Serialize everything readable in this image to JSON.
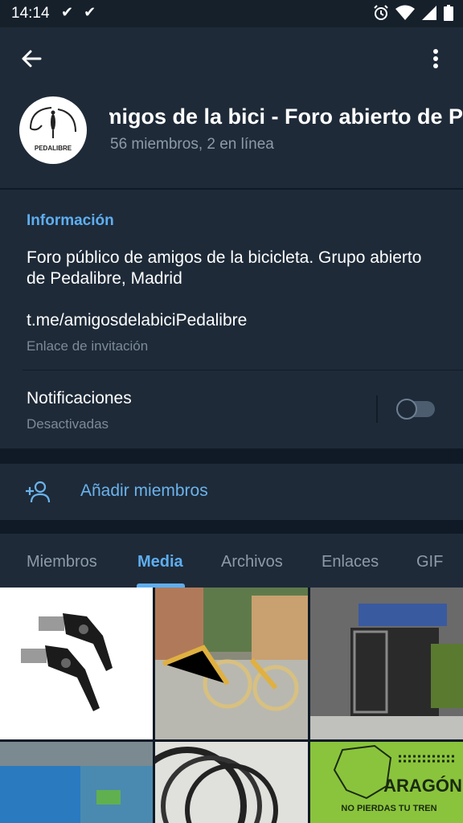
{
  "status_bar": {
    "time": "14:14",
    "checks": "✔ ✔"
  },
  "header": {
    "title": "Amigos de la bici - Foro abierto de Pedalibre    Amigos de la bici",
    "subtitle": "56 miembros, 2 en línea",
    "avatar_text": "PEDALIBRE"
  },
  "info": {
    "section_title": "Información",
    "description": "Foro público de amigos de la bicicleta. Grupo abierto de Pedalibre, Madrid",
    "link": "t.me/amigosdelabiciPedalibre",
    "link_label": "Enlace de invitación",
    "notifications_label": "Notificaciones",
    "notifications_state": "Desactivadas",
    "notifications_on": false
  },
  "add_members": {
    "label": "Añadir miembros"
  },
  "tabs": [
    {
      "label": "Miembros",
      "active": false
    },
    {
      "label": "Media",
      "active": true
    },
    {
      "label": "Archivos",
      "active": false
    },
    {
      "label": "Enlaces",
      "active": false
    },
    {
      "label": "GIF",
      "active": false
    }
  ],
  "media": {
    "thumb_6_line1": "ARAGÓN",
    "thumb_6_line2": "NO PIERDAS TU TREN"
  },
  "colors": {
    "accent": "#5eaef0",
    "panel": "#1e2a38",
    "background": "#0f1a26"
  }
}
